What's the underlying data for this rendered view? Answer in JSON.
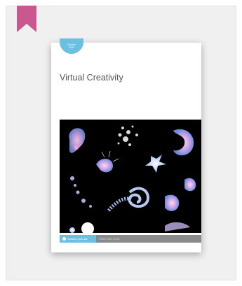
{
  "cover": {
    "title": "Virtual Creativity",
    "issue_line1": "Volume",
    "issue_line2": "2021",
    "publisher": "intellect journals",
    "issn": "ISSN 2397-9704"
  },
  "colors": {
    "bookmark": "#c8588f",
    "accent": "#6bbfe0",
    "frame": "#f0f0f0",
    "artwork_background": "#000000"
  },
  "icons": {
    "bookmark": "bookmark-icon",
    "publisher_logo": "intellect-logo-icon"
  }
}
